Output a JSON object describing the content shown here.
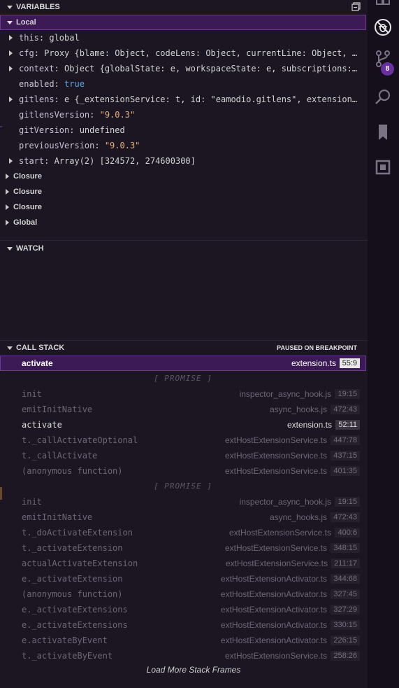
{
  "variables": {
    "header": "VARIABLES",
    "scopes_local": "Local",
    "local_vars": [
      {
        "name": "this",
        "value": "global",
        "kind": "val",
        "expandable": true
      },
      {
        "name": "cfg",
        "value": "Proxy {blame: Object, codeLens: Object, currentLine: Object, …",
        "kind": "val",
        "expandable": true
      },
      {
        "name": "context",
        "value": "Object {globalState: e, workspaceState: e, subscriptions:…",
        "kind": "val",
        "expandable": true
      },
      {
        "name": "enabled",
        "value": "true",
        "kind": "bool",
        "expandable": false
      },
      {
        "name": "gitlens",
        "value": "e {_extensionService: t, id: \"eamodio.gitlens\", extension…",
        "kind": "val",
        "expandable": true
      },
      {
        "name": "gitlensVersion",
        "value": "\"9.0.3\"",
        "kind": "str",
        "expandable": false
      },
      {
        "name": "gitVersion",
        "value": "undefined",
        "kind": "val",
        "expandable": false
      },
      {
        "name": "previousVersion",
        "value": "\"9.0.3\"",
        "kind": "str",
        "expandable": false
      },
      {
        "name": "start",
        "value": "Array(2) [324572, 274600300]",
        "kind": "val",
        "expandable": true
      }
    ],
    "other_scopes": [
      "Closure",
      "Closure",
      "Closure",
      "Global"
    ]
  },
  "watch": {
    "header": "WATCH"
  },
  "callstack": {
    "header": "CALL STACK",
    "status": "PAUSED ON BREAKPOINT",
    "promise_label": "[ PROMISE ]",
    "frames": [
      {
        "fn": "activate",
        "file": "extension.ts",
        "pos": "55:9",
        "style": "top"
      },
      {
        "promise": true
      },
      {
        "fn": "init",
        "file": "inspector_async_hook.js",
        "pos": "19:15",
        "style": "dim"
      },
      {
        "fn": "emitInitNative",
        "file": "async_hooks.js",
        "pos": "472:43",
        "style": "dim"
      },
      {
        "fn": "activate",
        "file": "extension.ts",
        "pos": "52:11",
        "style": "bright"
      },
      {
        "fn": "t._callActivateOptional",
        "file": "extHostExtensionService.ts",
        "pos": "447:78",
        "style": "dim"
      },
      {
        "fn": "t._callActivate",
        "file": "extHostExtensionService.ts",
        "pos": "437:15",
        "style": "dim"
      },
      {
        "fn": "(anonymous function)",
        "file": "extHostExtensionService.ts",
        "pos": "401:35",
        "style": "dim"
      },
      {
        "promise": true
      },
      {
        "fn": "init",
        "file": "inspector_async_hook.js",
        "pos": "19:15",
        "style": "dim"
      },
      {
        "fn": "emitInitNative",
        "file": "async_hooks.js",
        "pos": "472:43",
        "style": "dim"
      },
      {
        "fn": "t._doActivateExtension",
        "file": "extHostExtensionService.ts",
        "pos": "400:6",
        "style": "dim"
      },
      {
        "fn": "t._activateExtension",
        "file": "extHostExtensionService.ts",
        "pos": "348:15",
        "style": "dim"
      },
      {
        "fn": "actualActivateExtension",
        "file": "extHostExtensionService.ts",
        "pos": "211:17",
        "style": "dim"
      },
      {
        "fn": "e._activateExtension",
        "file": "extHostExtensionActivator.ts",
        "pos": "344:68",
        "style": "dim"
      },
      {
        "fn": "(anonymous function)",
        "file": "extHostExtensionActivator.ts",
        "pos": "327:45",
        "style": "dim"
      },
      {
        "fn": "e._activateExtensions",
        "file": "extHostExtensionActivator.ts",
        "pos": "327:29",
        "style": "dim"
      },
      {
        "fn": "e._activateExtensions",
        "file": "extHostExtensionActivator.ts",
        "pos": "330:15",
        "style": "dim"
      },
      {
        "fn": "e.activateByEvent",
        "file": "extHostExtensionActivator.ts",
        "pos": "226:15",
        "style": "dim"
      },
      {
        "fn": "t._activateByEvent",
        "file": "extHostExtensionService.ts",
        "pos": "258:26",
        "style": "dim"
      }
    ],
    "load_more": "Load More Stack Frames"
  },
  "activitybar": {
    "icons": [
      "extensions-icon",
      "debug-icon",
      "source-control-icon",
      "search-icon",
      "bookmark-icon",
      "remote-icon"
    ],
    "scm_badge": "8"
  },
  "colors": {
    "selection": "#3b1a55",
    "badge": "#6a2fa0",
    "string": "#e8b07a",
    "boolean": "#5aa2e6"
  }
}
